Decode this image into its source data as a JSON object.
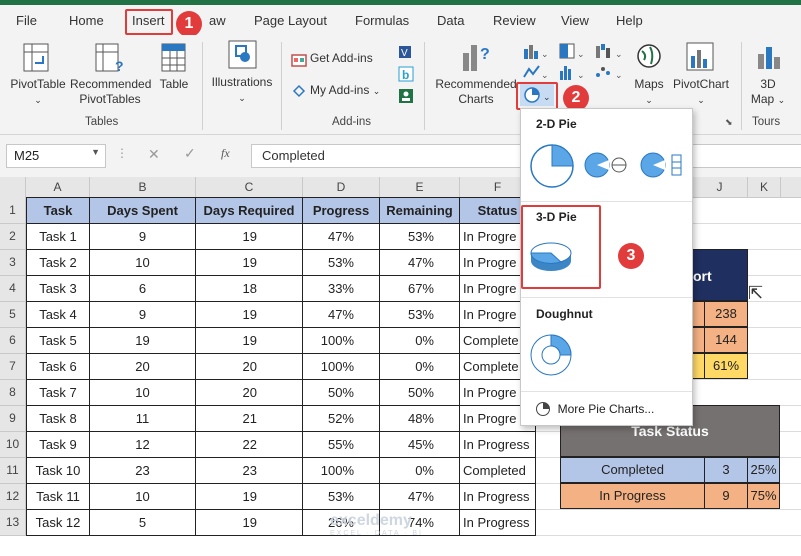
{
  "menu": {
    "tabs": [
      "File",
      "Home",
      "Insert",
      "Draw",
      "Page Layout",
      "Formulas",
      "Data",
      "Review",
      "View",
      "Help"
    ],
    "visible_draw": "aw"
  },
  "ribbon": {
    "pivottable": "PivotTable",
    "recommended_pivottables_1": "Recommended",
    "recommended_pivottables_2": "PivotTables",
    "table": "Table",
    "tables_group": "Tables",
    "illustrations": "Illustrations",
    "get_addins": "Get Add-ins",
    "my_addins": "My Add-ins",
    "addins_group": "Add-ins",
    "recommended_charts_1": "Recommended",
    "recommended_charts_2": "Charts",
    "maps": "Maps",
    "pivotchart": "PivotChart",
    "map3d_1": "3D",
    "map3d_2": "Map",
    "tours_group": "Tours"
  },
  "callouts": [
    "1",
    "2",
    "3"
  ],
  "formula_bar": {
    "name_box": "M25",
    "fx": "fx",
    "value": "Completed"
  },
  "columns": [
    "A",
    "B",
    "C",
    "D",
    "E",
    "F",
    "J",
    "K"
  ],
  "rows": [
    "1",
    "2",
    "3",
    "4",
    "5",
    "6",
    "7",
    "8",
    "9",
    "10",
    "11",
    "12",
    "13"
  ],
  "table": {
    "headers": [
      "Task",
      "Days Spent",
      "Days Required",
      "Progress",
      "Remaining",
      "Status"
    ],
    "rows": [
      [
        "Task 1",
        "9",
        "19",
        "47%",
        "53%",
        "In Progre"
      ],
      [
        "Task 2",
        "10",
        "19",
        "53%",
        "47%",
        "In Progre"
      ],
      [
        "Task 3",
        "6",
        "18",
        "33%",
        "67%",
        "In Progre"
      ],
      [
        "Task 4",
        "9",
        "19",
        "47%",
        "53%",
        "In Progre"
      ],
      [
        "Task 5",
        "19",
        "19",
        "100%",
        "0%",
        "Complete"
      ],
      [
        "Task 6",
        "20",
        "20",
        "100%",
        "0%",
        "Complete"
      ],
      [
        "Task 7",
        "10",
        "20",
        "50%",
        "50%",
        "In Progre"
      ],
      [
        "Task 8",
        "11",
        "21",
        "52%",
        "48%",
        "In Progre"
      ],
      [
        "Task 9",
        "12",
        "22",
        "55%",
        "45%",
        "In Progress"
      ],
      [
        "Task 10",
        "23",
        "23",
        "100%",
        "0%",
        "Completed"
      ],
      [
        "Task 11",
        "10",
        "19",
        "53%",
        "47%",
        "In Progress"
      ],
      [
        "Task 12",
        "5",
        "19",
        "26%",
        "74%",
        "In Progress"
      ]
    ]
  },
  "report": {
    "header_fragment": "ort",
    "values": [
      "238",
      "144",
      "61%"
    ]
  },
  "task_status": {
    "title": "Task Status",
    "rows": [
      {
        "label": "Completed",
        "count": "3",
        "pct": "25%"
      },
      {
        "label": "In Progress",
        "count": "9",
        "pct": "75%"
      }
    ]
  },
  "pie_menu": {
    "pie2d": "2-D Pie",
    "pie3d": "3-D Pie",
    "doughnut": "Doughnut",
    "more": "More Pie Charts..."
  },
  "colors": {
    "excel_green": "#217346",
    "header_blue": "#b4c6e7",
    "navy": "#1f2f5f",
    "orange": "#f4b183",
    "yellow": "#ffd966",
    "status_gray": "#767171",
    "callout_red": "#e23b3b",
    "pie_blue": "#5aa6e6"
  },
  "watermark": {
    "name": "exceldemy",
    "tagline": "EXCEL · DATA · BI"
  }
}
